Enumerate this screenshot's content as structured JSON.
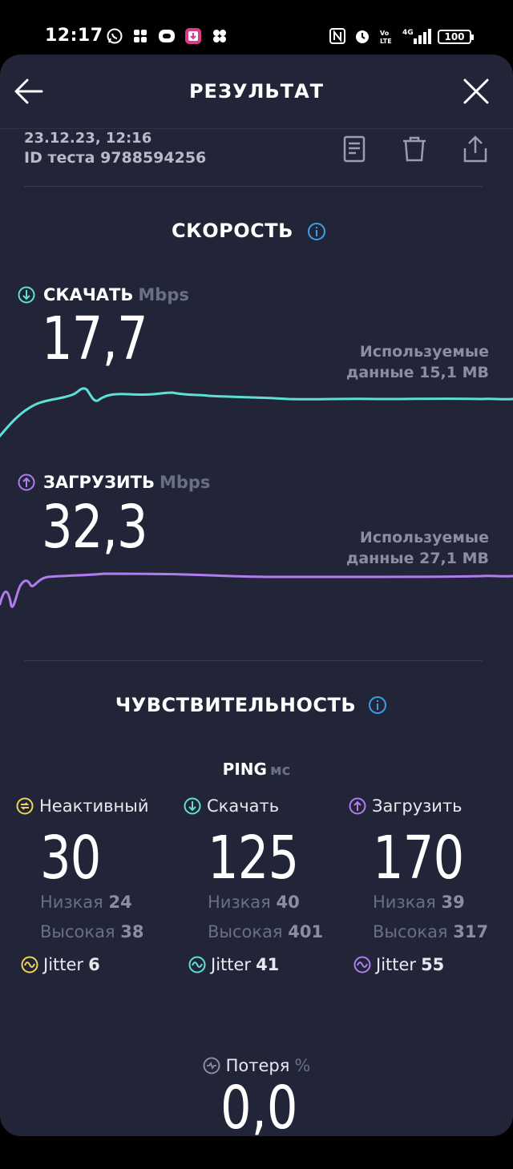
{
  "status_bar": {
    "time": "12:17",
    "battery": "100"
  },
  "header": {
    "title": "РЕЗУЛЬТАТ"
  },
  "meta": {
    "date": "23.12.23, 12:16",
    "test_id": "ID теста 9788594256"
  },
  "speed": {
    "title": "СКОРОСТЬ",
    "download": {
      "label": "СКАЧАТЬ",
      "unit": "Mbps",
      "value": "17,7",
      "used_line1": "Используемые",
      "used_line2": "данные 15,1 MB",
      "color": "#5ee0d6"
    },
    "upload": {
      "label": "ЗАГРУЗИТЬ",
      "unit": "Mbps",
      "value": "32,3",
      "used_line1": "Используемые",
      "used_line2": "данные 27,1 MB",
      "color": "#b07cf0"
    }
  },
  "sensitivity": {
    "title": "ЧУВСТВИТЕЛЬНОСТЬ",
    "ping_label": "PING",
    "ping_unit": "мс",
    "columns": [
      {
        "label": "Неактивный",
        "value": "30",
        "low_label": "Низкая",
        "low": "24",
        "high_label": "Высокая",
        "high": "38",
        "jitter_label": "Jitter",
        "jitter": "6",
        "color": "#f2d35a"
      },
      {
        "label": "Скачать",
        "value": "125",
        "low_label": "Низкая",
        "low": "40",
        "high_label": "Высокая",
        "high": "401",
        "jitter_label": "Jitter",
        "jitter": "41",
        "color": "#5ee0d6"
      },
      {
        "label": "Загрузить",
        "value": "170",
        "low_label": "Низкая",
        "low": "39",
        "high_label": "Высокая",
        "high": "317",
        "jitter_label": "Jitter",
        "jitter": "55",
        "color": "#b07cf0"
      }
    ],
    "loss": {
      "label": "Потеря",
      "unit": "%",
      "value": "0,0"
    }
  }
}
